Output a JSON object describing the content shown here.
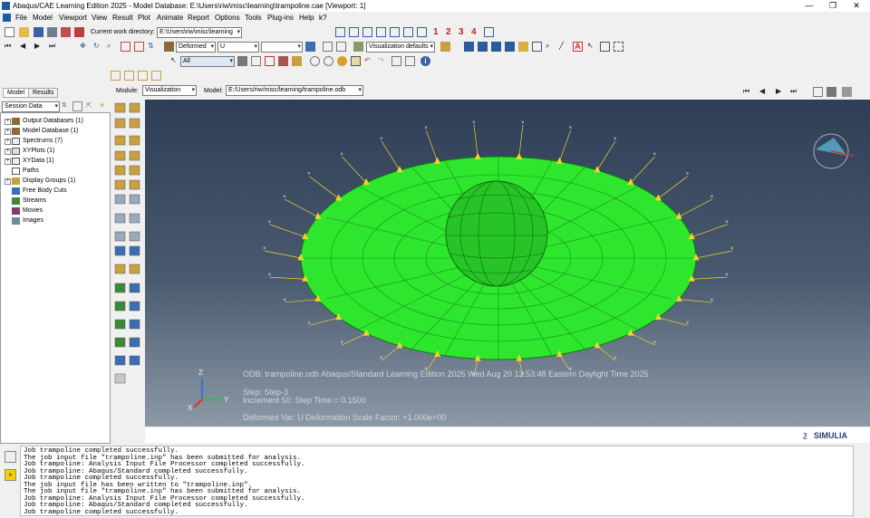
{
  "window": {
    "title": "Abaqus/CAE Learning Edition 2025 - Model Database: E:\\Users\\riw\\misc\\learning\\trampoline.cae [Viewport: 1]",
    "minimize": "—",
    "restore": "❐",
    "close": "✕"
  },
  "menu": [
    "File",
    "Model",
    "Viewport",
    "View",
    "Result",
    "Plot",
    "Animate",
    "Report",
    "Options",
    "Tools",
    "Plug-ins",
    "Help",
    "k?"
  ],
  "toolbar": {
    "cwd_label": "Current work directory:",
    "cwd_value": "E:\\Users\\riw\\misc\\learning",
    "plot_state": "Deformed",
    "field_var": "U",
    "field_comp": "",
    "view_style": "Visualization defaults",
    "selection_filter": "All",
    "viewport_numbers": [
      "1",
      "2",
      "3",
      "4"
    ]
  },
  "context": {
    "module_label": "Module:",
    "module_value": "Visualization",
    "model_label": "Model:",
    "model_value": "E:/Users/riw/misc/learning/trampoline.odb"
  },
  "tabs": {
    "model": "Model",
    "results": "Results"
  },
  "session": {
    "selector": "Session Data",
    "tree": [
      {
        "label": "Output Databases (1)",
        "expandable": true
      },
      {
        "label": "Model Database (1)",
        "expandable": true
      },
      {
        "label": "Spectrums (7)",
        "expandable": true
      },
      {
        "label": "XYPlots (1)",
        "expandable": true
      },
      {
        "label": "XYData (1)",
        "expandable": true
      },
      {
        "label": "Paths",
        "expandable": false
      },
      {
        "label": "Display Groups (1)",
        "expandable": true
      },
      {
        "label": "Free Body Cuts",
        "expandable": false
      },
      {
        "label": "Streams",
        "expandable": false
      },
      {
        "label": "Movies",
        "expandable": false
      },
      {
        "label": "Images",
        "expandable": false
      }
    ]
  },
  "viewport": {
    "odb_line": "ODB: trampoline.odb    Abaqus/Standard Learning Edition 2025    Wed Aug 20 12:53:48 Eastern Daylight Time 2025",
    "step_line": "Step: Step-3",
    "increment_line": "Increment     50: Step Time =    0.1500",
    "deformed_line": "Deformed Var: U   Deformation Scale Factor: +1.000e+00",
    "triad": {
      "x": "X",
      "y": "Y",
      "z": "Z"
    },
    "mesh_color": "#2ee62e",
    "load_color": "#f2d22a",
    "background_top": "#2e3e56",
    "background_bottom": "#8c99a6"
  },
  "brand": "SIMULIA",
  "messages": [
    "Job trampoline completed successfully.",
    "The job input file \"trampoline.inp\" has been submitted for analysis.",
    "Job trampoline: Analysis Input File Processor completed successfully.",
    "Job trampoline: Abaqus/Standard completed successfully.",
    "Job trampoline completed successfully.",
    "The job input file has been written to \"trampoline.inp\".",
    "The job input file \"trampoline.inp\" has been submitted for analysis.",
    "Job trampoline: Analysis Input File Processor completed successfully.",
    "Job trampoline: Abaqus/Standard completed successfully.",
    "Job trampoline completed successfully."
  ]
}
